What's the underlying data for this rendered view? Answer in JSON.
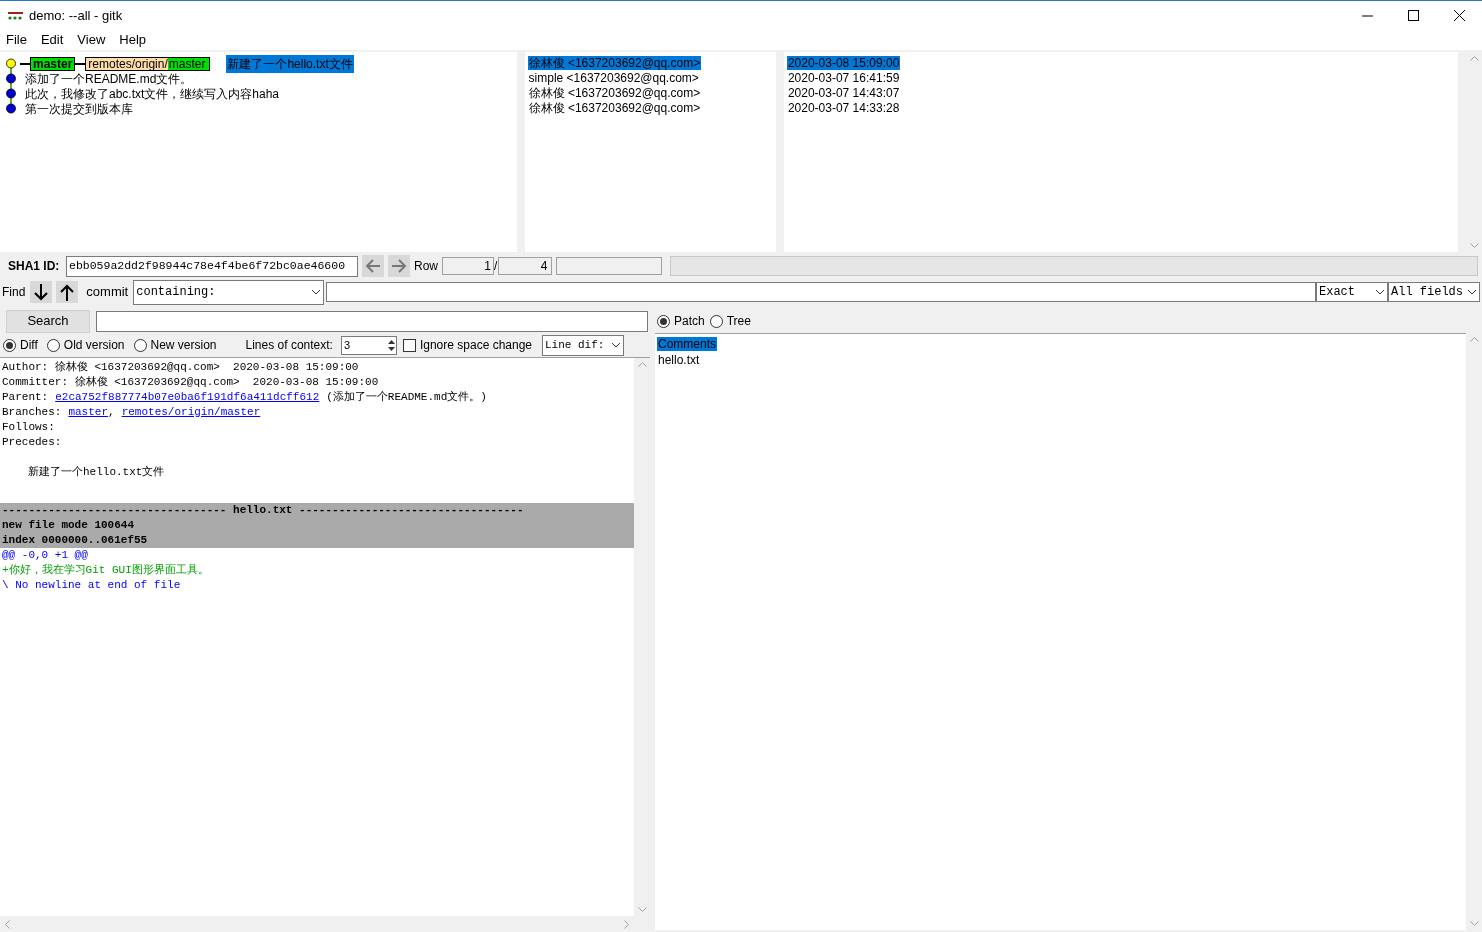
{
  "window": {
    "title": "demo: --all - gitk"
  },
  "menu": [
    "File",
    "Edit",
    "View",
    "Help"
  ],
  "commits": [
    {
      "head": true,
      "selected": true,
      "subject": "新建了一个hello.txt文件",
      "author": "徐林俊 <1637203692@qq.com>",
      "date": "2020-03-08 15:09:00",
      "refs": [
        {
          "kind": "local",
          "name": "master"
        },
        {
          "kind": "remote",
          "prefix": "remotes/origin/",
          "name": "master"
        }
      ]
    },
    {
      "head": false,
      "selected": false,
      "subject": "添加了一个README.md文件。",
      "author": "simple <1637203692@qq.com>",
      "date": "2020-03-07 16:41:59"
    },
    {
      "head": false,
      "selected": false,
      "subject": "此次，我修改了abc.txt文件，继续写入内容haha",
      "author": "徐林俊 <1637203692@qq.com>",
      "date": "2020-03-07 14:43:07"
    },
    {
      "head": false,
      "selected": false,
      "subject": "第一次提交到版本库",
      "author": "徐林俊 <1637203692@qq.com>",
      "date": "2020-03-07 14:33:28"
    }
  ],
  "sha1": {
    "label": "SHA1 ID:",
    "value": "ebb059a2dd2f98944c78e4f4be6f72bc0ae46600"
  },
  "row": {
    "label": "Row",
    "current": "1",
    "separator": "/",
    "total": "4"
  },
  "find": {
    "label": "Find",
    "type": "commit",
    "mode": "containing:",
    "match": "Exact",
    "fields": "All fields"
  },
  "progress": {
    "level": 0
  },
  "search_button": "Search",
  "diff_modes": [
    {
      "label": "Diff",
      "selected": true
    },
    {
      "label": "Old version",
      "selected": false
    },
    {
      "label": "New version",
      "selected": false
    }
  ],
  "context": {
    "label": "Lines of context:",
    "value": "3"
  },
  "ignore_space": {
    "label": "Ignore space change",
    "checked": false
  },
  "diff_style": "Line dif:",
  "view_modes": [
    {
      "label": "Patch",
      "selected": true
    },
    {
      "label": "Tree",
      "selected": false
    }
  ],
  "details": [
    {
      "kind": "text",
      "text": "Author: 徐林俊 <1637203692@qq.com>  2020-03-08 15:09:00"
    },
    {
      "kind": "text",
      "text": "Committer: 徐林俊 <1637203692@qq.com>  2020-03-08 15:09:00"
    },
    {
      "kind": "links",
      "label": "Parent:",
      "links": [
        "e2ca752f887774b07e0ba6f191df6a411dcff612"
      ],
      "suffix": "(添加了一个README.md文件。)"
    },
    {
      "kind": "links",
      "label": "Branches:",
      "links": [
        "master",
        "remotes/origin/master"
      ],
      "separator": ","
    },
    {
      "kind": "text",
      "text": "Follows:"
    },
    {
      "kind": "text",
      "text": "Precedes:"
    },
    {
      "kind": "blank"
    },
    {
      "kind": "message",
      "text": "新建了一个hello.txt文件"
    },
    {
      "kind": "blank"
    }
  ],
  "diff": [
    {
      "kind": "file",
      "text": "---------------------------------- hello.txt ----------------------------------"
    },
    {
      "kind": "meta",
      "text": "new file mode 100644"
    },
    {
      "kind": "meta",
      "text": "index 0000000..061ef55"
    },
    {
      "kind": "hunk",
      "text": "@@ -0,0 +1 @@"
    },
    {
      "kind": "add",
      "text": "+你好，我在学习Git GUI图形界面工具。"
    },
    {
      "kind": "note",
      "text": "\\ No newline at end of file"
    }
  ],
  "files": [
    {
      "label": "Comments",
      "selected": true
    },
    {
      "label": "hello.txt",
      "selected": false
    }
  ]
}
